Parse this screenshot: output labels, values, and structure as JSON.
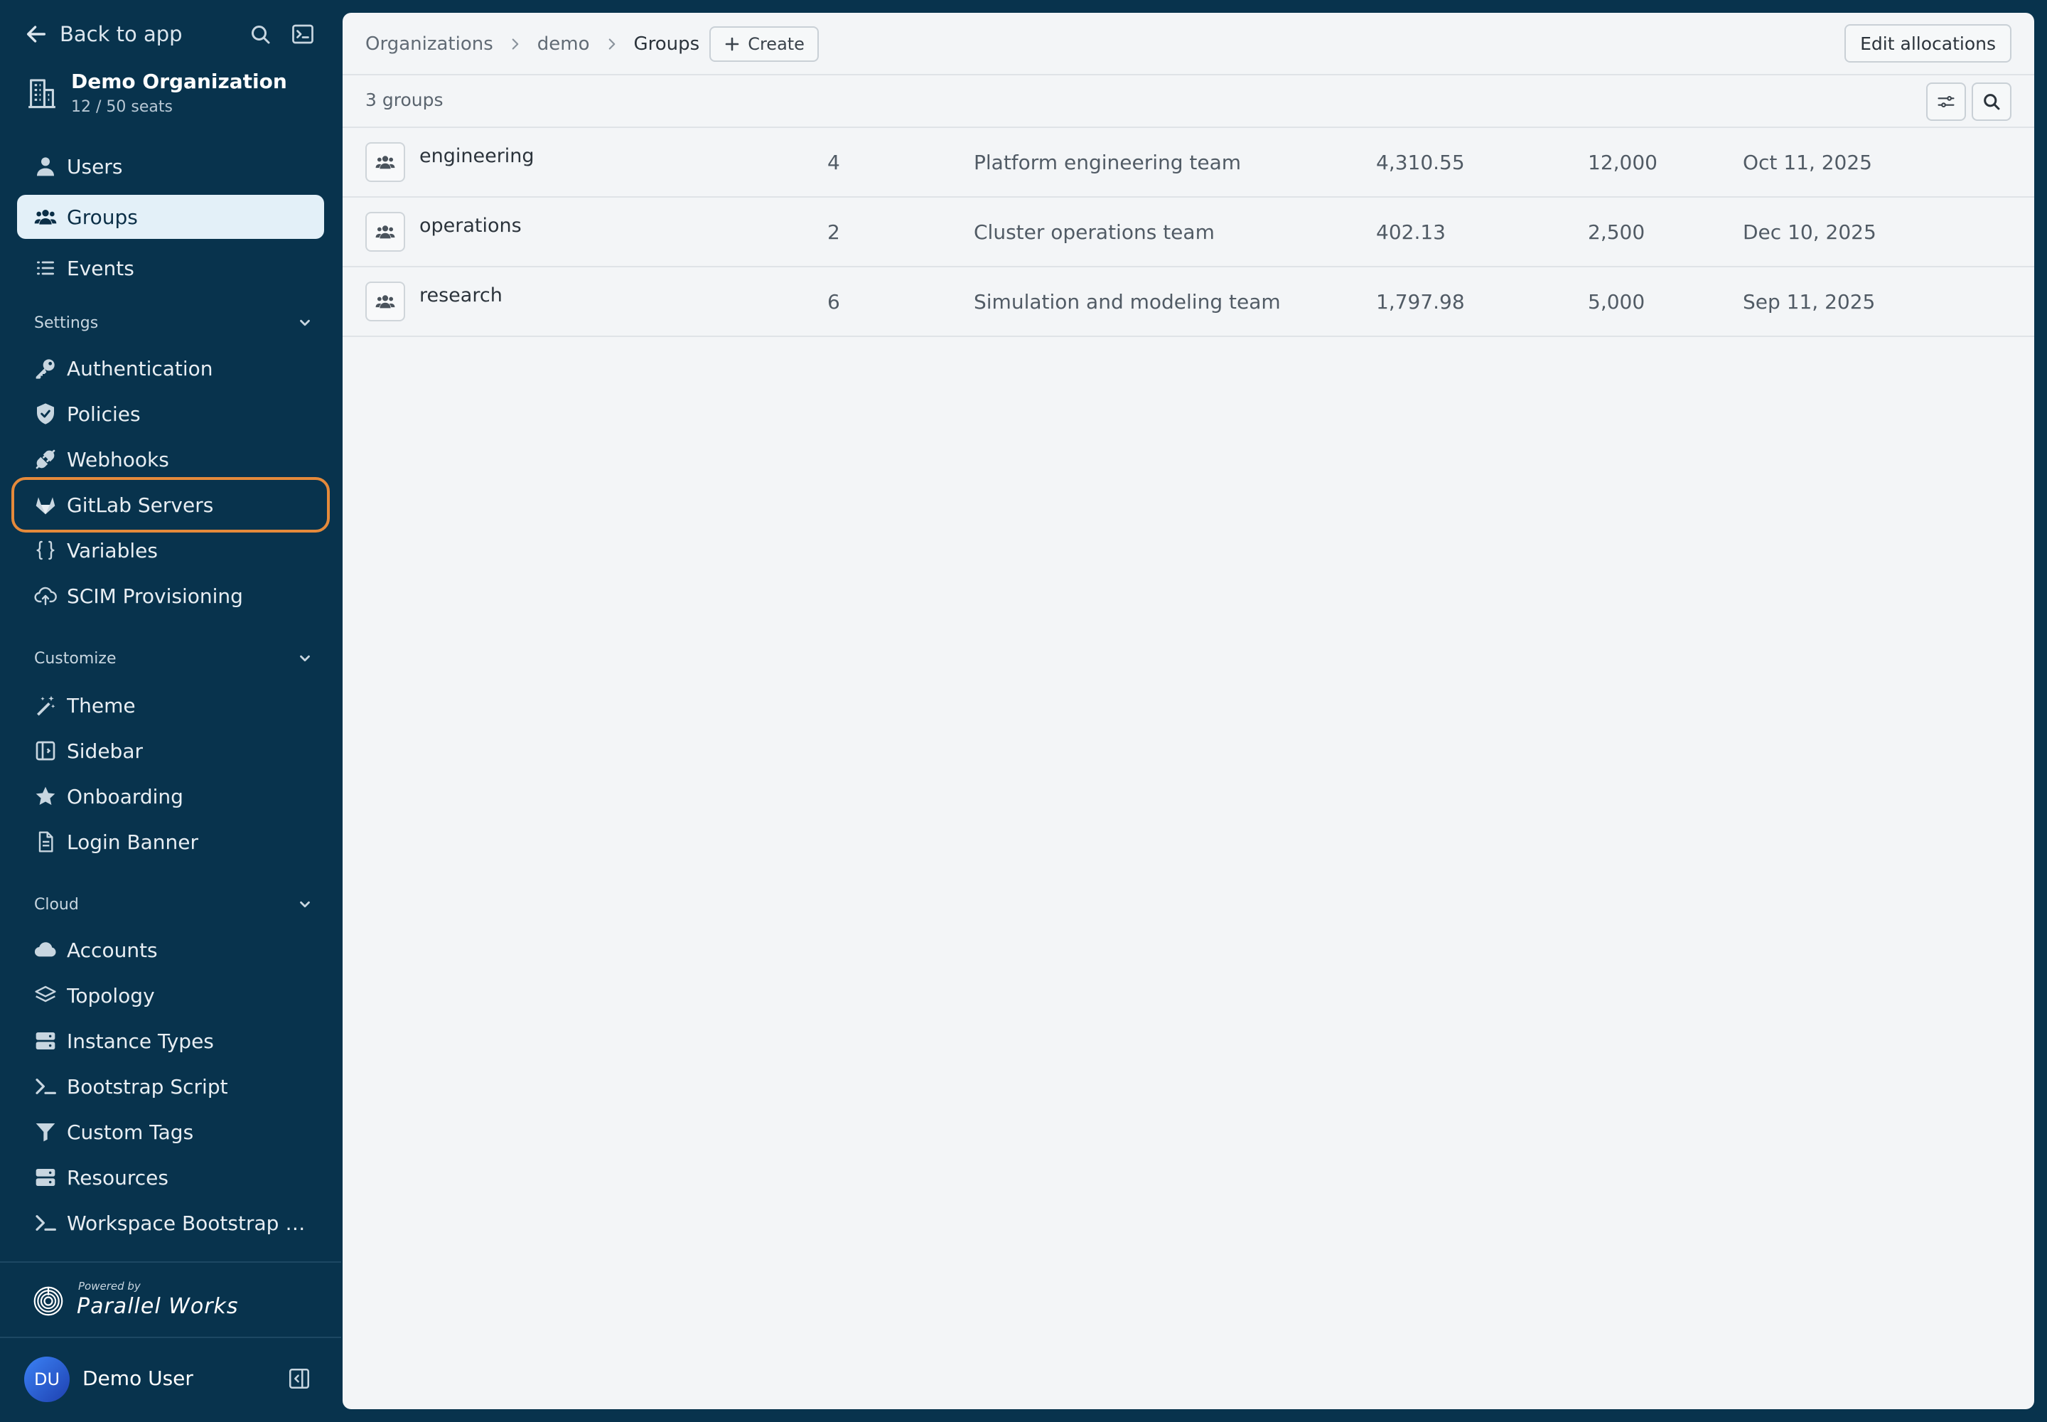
{
  "sidebar": {
    "back_label": "Back to app",
    "org": {
      "name": "Demo Organization",
      "seats": "12 / 50 seats"
    },
    "main_items": [
      {
        "label": "Users",
        "icon": "user-icon"
      },
      {
        "label": "Groups",
        "icon": "users-icon",
        "active": true
      },
      {
        "label": "Events",
        "icon": "list-icon"
      }
    ],
    "settings": {
      "title": "Settings",
      "items": [
        {
          "label": "Authentication",
          "icon": "key-icon"
        },
        {
          "label": "Policies",
          "icon": "shield-icon"
        },
        {
          "label": "Webhooks",
          "icon": "plug-icon"
        },
        {
          "label": "GitLab Servers",
          "icon": "gitlab-icon",
          "highlighted": true
        },
        {
          "label": "Variables",
          "icon": "braces-icon"
        },
        {
          "label": "SCIM Provisioning",
          "icon": "cloud-upload-icon"
        }
      ]
    },
    "customize": {
      "title": "Customize",
      "items": [
        {
          "label": "Theme",
          "icon": "magic-wand-icon"
        },
        {
          "label": "Sidebar",
          "icon": "sidebar-icon"
        },
        {
          "label": "Onboarding",
          "icon": "star-icon"
        },
        {
          "label": "Login Banner",
          "icon": "document-icon"
        }
      ]
    },
    "cloud": {
      "title": "Cloud",
      "items": [
        {
          "label": "Accounts",
          "icon": "cloud-icon"
        },
        {
          "label": "Topology",
          "icon": "layers-icon"
        },
        {
          "label": "Instance Types",
          "icon": "server-icon"
        },
        {
          "label": "Bootstrap Script",
          "icon": "terminal-icon"
        },
        {
          "label": "Custom Tags",
          "icon": "filter-icon"
        },
        {
          "label": "Resources",
          "icon": "server-icon"
        },
        {
          "label": "Workspace Bootstrap S...",
          "icon": "terminal-icon"
        }
      ]
    },
    "powered_by": {
      "small": "Powered by",
      "brand": "Parallel Works"
    },
    "user": {
      "initials": "DU",
      "name": "Demo User"
    }
  },
  "breadcrumb": {
    "items": [
      "Organizations",
      "demo",
      "Groups"
    ]
  },
  "toolbar": {
    "create_label": "Create",
    "edit_allocations_label": "Edit allocations"
  },
  "list": {
    "count_label": "3 groups",
    "rows": [
      {
        "name": "engineering",
        "members": "4",
        "description": "Platform engineering team",
        "used": "4,310.55",
        "allocation": "12,000",
        "date": "Oct 11, 2025"
      },
      {
        "name": "operations",
        "members": "2",
        "description": "Cluster operations team",
        "used": "402.13",
        "allocation": "2,500",
        "date": "Dec 10, 2025"
      },
      {
        "name": "research",
        "members": "6",
        "description": "Simulation and modeling team",
        "used": "1,797.98",
        "allocation": "5,000",
        "date": "Sep 11, 2025"
      }
    ]
  },
  "colors": {
    "sidebar_bg": "#08334d",
    "active_item_bg": "#e3f0f8",
    "highlight_outline": "#e58a3b",
    "main_bg": "#f3f5f7"
  }
}
